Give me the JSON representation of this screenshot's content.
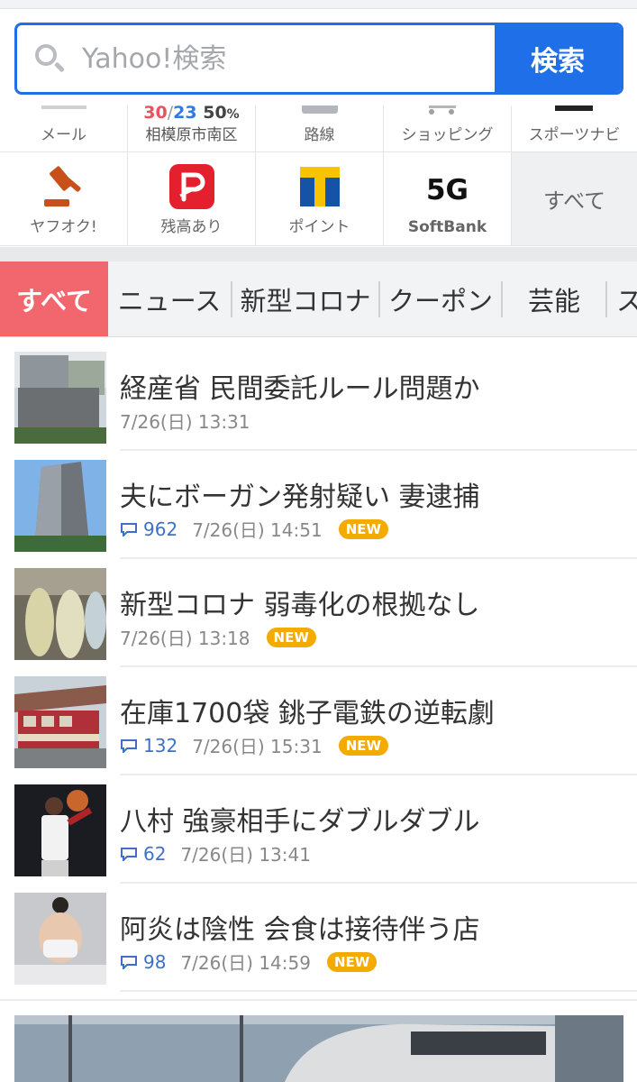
{
  "search": {
    "placeholder": "Yahoo!検索",
    "button_label": "検索"
  },
  "services_row1": [
    {
      "label": "メール",
      "icon": "mail-icon"
    },
    {
      "label": "相模原市南区",
      "icon": "weather-icon",
      "temp_high": "30",
      "temp_low": "23",
      "precip": "50",
      "precip_unit": "%"
    },
    {
      "label": "路線",
      "icon": "train-icon"
    },
    {
      "label": "ショッピング",
      "icon": "cart-icon"
    },
    {
      "label": "スポーツナビ",
      "icon": "sports-icon"
    }
  ],
  "services_row2": [
    {
      "label": "ヤフオク!",
      "icon": "auction-gavel-icon"
    },
    {
      "label": "残高あり",
      "icon": "paypay-icon"
    },
    {
      "label": "ポイント",
      "icon": "tpoint-icon"
    },
    {
      "label": "SoftBank",
      "icon": "5g-icon",
      "icon_text": "5G"
    },
    {
      "label": "すべて",
      "icon": ""
    }
  ],
  "tabs": [
    "すべて",
    "ニュース",
    "新型コロナ",
    "クーポン",
    "芸能",
    "ス"
  ],
  "news": [
    {
      "title": "経産省 民間委託ルール問題か",
      "comments": "",
      "date": "7/26(日) 13:31",
      "badge": ""
    },
    {
      "title": "夫にボーガン発射疑い 妻逮捕",
      "comments": "962",
      "date": "7/26(日) 14:51",
      "badge": "NEW"
    },
    {
      "title": "新型コロナ 弱毒化の根拠なし",
      "comments": "",
      "date": "7/26(日) 13:18",
      "badge": "NEW"
    },
    {
      "title": "在庫1700袋 銚子電鉄の逆転劇",
      "comments": "132",
      "date": "7/26(日) 15:31",
      "badge": "NEW"
    },
    {
      "title": "八村 強豪相手にダブルダブル",
      "comments": "62",
      "date": "7/26(日) 13:41",
      "badge": ""
    },
    {
      "title": "阿炎は陰性 会食は接待伴う店",
      "comments": "98",
      "date": "7/26(日) 14:59",
      "badge": "NEW"
    }
  ],
  "colors": {
    "accent_blue": "#1e6fe8",
    "tab_active": "#f2676e",
    "badge_orange": "#f4ab00",
    "comment_blue": "#3f70c8"
  }
}
